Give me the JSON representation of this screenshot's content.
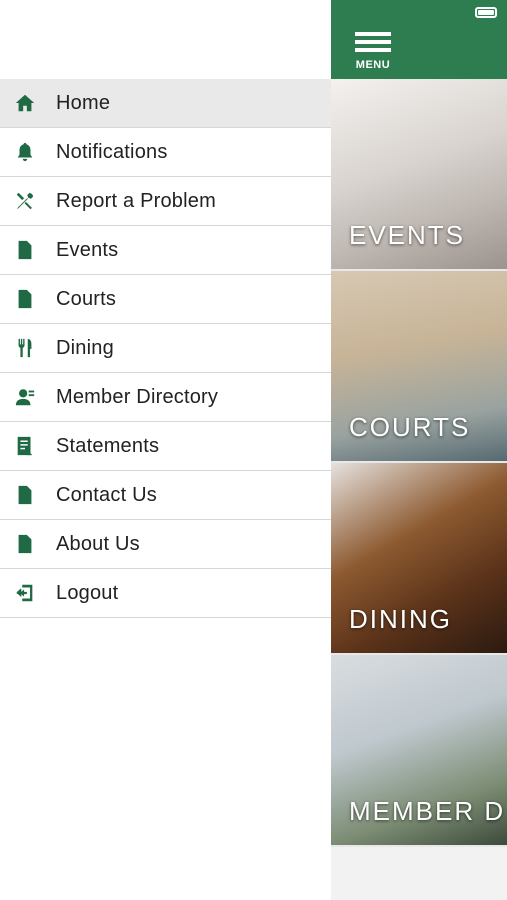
{
  "drawer": {
    "items": [
      {
        "label": "Home",
        "icon": "home-icon",
        "active": true
      },
      {
        "label": "Notifications",
        "icon": "bell-icon",
        "active": false
      },
      {
        "label": "Report a Problem",
        "icon": "tools-icon",
        "active": false
      },
      {
        "label": "Events",
        "icon": "document-icon",
        "active": false
      },
      {
        "label": "Courts",
        "icon": "document-icon",
        "active": false
      },
      {
        "label": "Dining",
        "icon": "utensils-icon",
        "active": false
      },
      {
        "label": "Member Directory",
        "icon": "member-icon",
        "active": false
      },
      {
        "label": "Statements",
        "icon": "statement-icon",
        "active": false
      },
      {
        "label": "Contact Us",
        "icon": "document-icon",
        "active": false
      },
      {
        "label": "About Us",
        "icon": "document-icon",
        "active": false
      },
      {
        "label": "Logout",
        "icon": "logout-icon",
        "active": false
      }
    ]
  },
  "topbar": {
    "menu_label": "MENU"
  },
  "tiles": [
    {
      "label": "EVENTS"
    },
    {
      "label": "COURTS"
    },
    {
      "label": "DINING"
    },
    {
      "label": "MEMBER D"
    }
  ],
  "colors": {
    "brand_green": "#2e7d51",
    "icon_green": "#1f6a45",
    "active_bg": "#e9e9e9"
  }
}
